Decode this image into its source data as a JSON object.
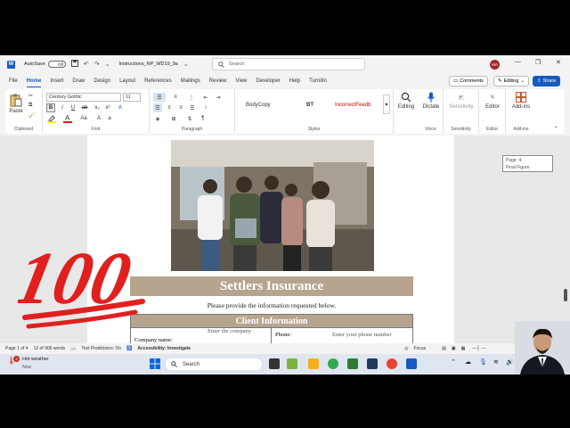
{
  "titlebar": {
    "app_logo": "W",
    "autosave_label": "AutoSave",
    "autosave_state": "Off",
    "doc_name": "Instructions_NP_WD19_9a",
    "search_placeholder": "Search",
    "avatar_initials": "MA",
    "icons": [
      "word-icon",
      "save-icon",
      "undo-icon",
      "redo-icon",
      "search-icon",
      "minimize-icon",
      "restore-icon",
      "close-icon"
    ]
  },
  "menu": {
    "tabs": [
      "File",
      "Home",
      "Insert",
      "Draw",
      "Design",
      "Layout",
      "References",
      "Mailings",
      "Review",
      "View",
      "Developer",
      "Help",
      "Turnitin"
    ],
    "active": "Home",
    "comments_label": "Comments",
    "editing_label": "Editing",
    "share_label": "Share"
  },
  "ribbon": {
    "paste_label": "Paste",
    "clipboard_label": "Clipboard",
    "font_name": "Century Gothic",
    "font_size": "11",
    "font_label": "Font",
    "paragraph_label": "Paragraph",
    "styles": [
      "BodyCopy",
      "BT",
      "IncorrectFeedb"
    ],
    "styles_label": "Styles",
    "editing_btn": "Editing",
    "dictate_btn": "Dictate",
    "voice_label": "Voice",
    "sensitivity_btn": "Sensitivity",
    "sensitivity_label": "Sensitivity",
    "editor_btn": "Editor",
    "editor_label": "Editor",
    "addins_btn": "Add-ins",
    "addins_label": "Add-ins"
  },
  "document": {
    "banner_title": "Settlers Insurance",
    "instruction": "Please provide the information requested below.",
    "client_header": "Client Information",
    "company_label": "Company name:",
    "company_placeholder": "Enter the company",
    "phone_label": "Phone:",
    "phone_placeholder": "Enter your phone number",
    "stamp_text": "100"
  },
  "comment": {
    "line1": "Page: 4",
    "line2": "Final Figure"
  },
  "statusbar": {
    "page": "Page 1 of 4",
    "words": "12 of 906 words",
    "predictions": "Text Predictions: On",
    "accessibility": "Accessibility: Investigate",
    "focus": "Focus"
  },
  "taskbar": {
    "weather_badge": "2",
    "weather_title": "Hot weather",
    "weather_sub": "Now",
    "search_label": "Search"
  },
  "colors": {
    "accent": "#185abd",
    "banner": "#b7a48e",
    "stamp": "#e0201f"
  }
}
